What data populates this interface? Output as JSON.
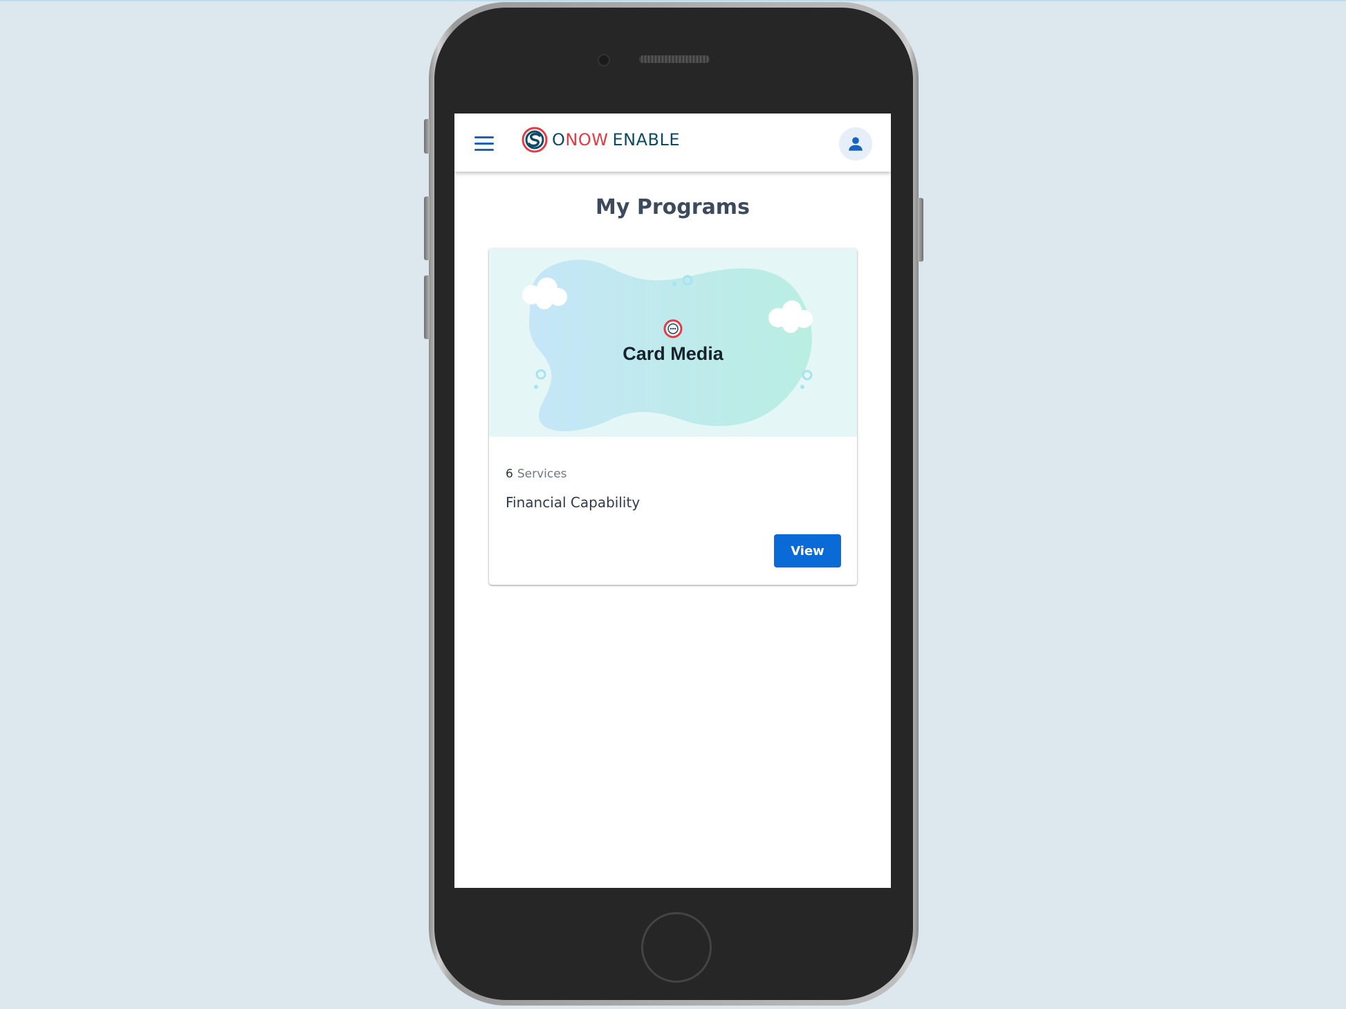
{
  "colors": {
    "background": "#dce8ee",
    "accent": "#0b6bd6",
    "brand_red": "#e63946",
    "brand_navy": "#0d4a66",
    "title_text": "#3d4a5c"
  },
  "header": {
    "menu_icon": "hamburger-menu-icon",
    "logo_icon": "onow-s-logo-icon",
    "brand_part1": "O",
    "brand_part2": "NOW",
    "brand_part3": "ENABLE",
    "account_icon": "person-icon"
  },
  "main": {
    "title": "My Programs",
    "programs": [
      {
        "media_label": "Card Media",
        "media_icon": "chat-bubble-icon",
        "service_count": "6",
        "service_label": "Services",
        "name": "Financial Capability",
        "action_label": "View"
      }
    ]
  }
}
